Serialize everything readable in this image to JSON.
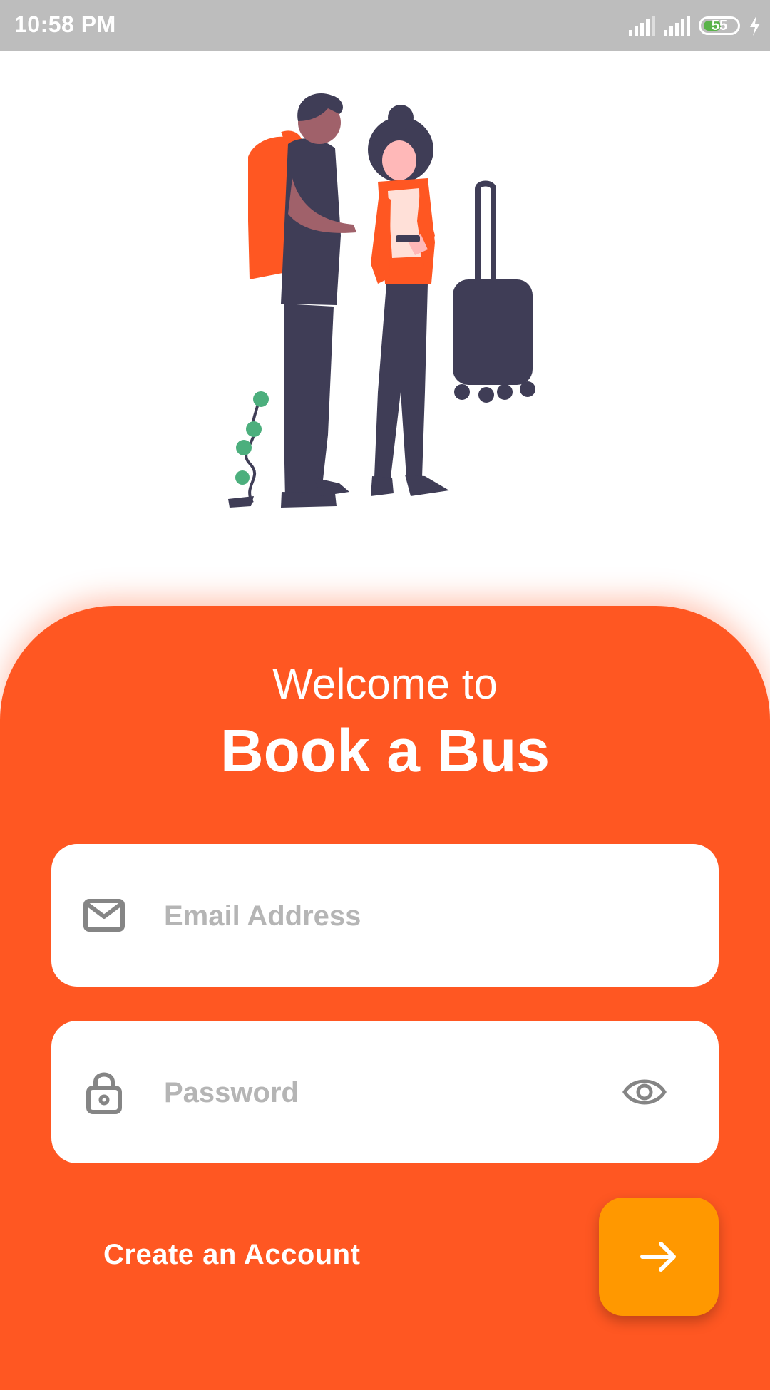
{
  "status_bar": {
    "time": "10:58 PM",
    "battery_level": "55",
    "battery_fraction": 0.55,
    "icons": [
      "signal-icon",
      "signal-icon",
      "battery-icon",
      "charging-bolt-icon"
    ]
  },
  "hero": {
    "icon": "travelers-illustration"
  },
  "welcome": {
    "line1": "Welcome to",
    "line2": "Book a Bus"
  },
  "form": {
    "email": {
      "placeholder": "Email Address",
      "value": "",
      "icon": "mail-icon"
    },
    "password": {
      "placeholder": "Password",
      "value": "",
      "icon": "lock-icon",
      "toggle_icon": "eye-icon"
    }
  },
  "actions": {
    "create_account": "Create an Account",
    "submit_icon": "arrow-right-icon"
  },
  "colors": {
    "primary": "#ff5722",
    "accent": "#ff9800",
    "status_bar": "#bdbdbd",
    "placeholder": "#b5b5b5",
    "icon": "#858585"
  }
}
